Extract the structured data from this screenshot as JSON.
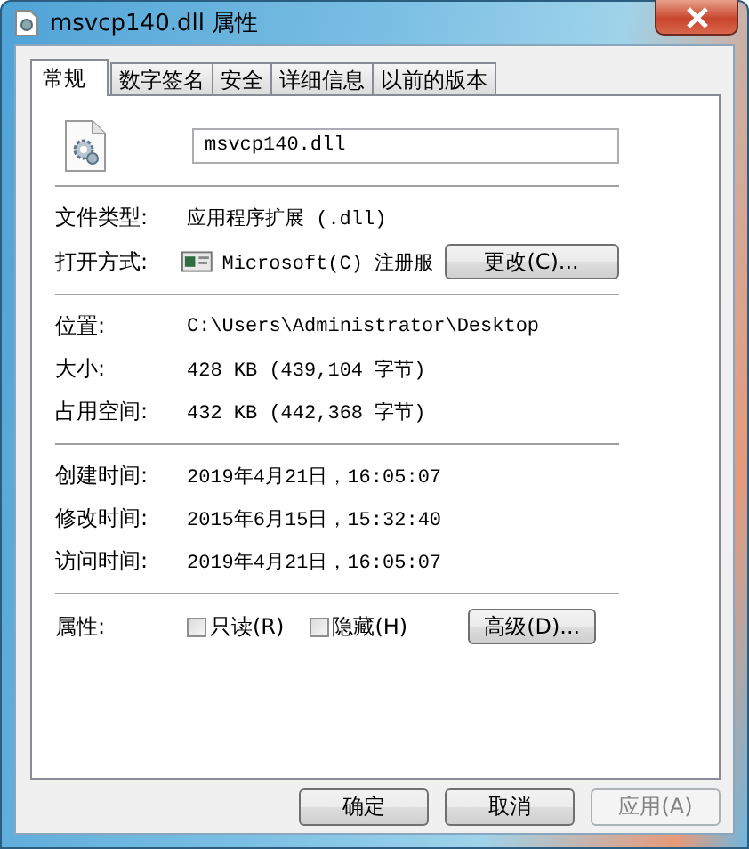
{
  "window": {
    "title": "msvcp140.dll 属性"
  },
  "tabs": [
    {
      "label": "常规",
      "selected": true
    },
    {
      "label": "数字签名",
      "selected": false
    },
    {
      "label": "安全",
      "selected": false
    },
    {
      "label": "详细信息",
      "selected": false
    },
    {
      "label": "以前的版本",
      "selected": false
    }
  ],
  "file_name": {
    "value": "msvcp140.dll"
  },
  "groups": [
    [
      {
        "kind": "text",
        "label": "文件类型:",
        "value": "应用程序扩展 (.dll)"
      },
      {
        "kind": "opens_with",
        "label": "打开方式:",
        "value": "Microsoft(C) 注册服",
        "button": "更改(C)..."
      }
    ],
    [
      {
        "kind": "text",
        "label": "位置:",
        "value": "C:\\Users\\Administrator\\Desktop"
      },
      {
        "kind": "text",
        "label": "大小:",
        "value": "428 KB (439,104 字节)"
      },
      {
        "kind": "text",
        "label": "占用空间:",
        "value": "432 KB (442,368 字节)"
      }
    ],
    [
      {
        "kind": "text",
        "label": "创建时间:",
        "value": "2019年4月21日，16:05:07"
      },
      {
        "kind": "text",
        "label": "修改时间:",
        "value": "2015年6月15日，15:32:40"
      },
      {
        "kind": "text",
        "label": "访问时间:",
        "value": "2019年4月21日，16:05:07"
      }
    ],
    [
      {
        "kind": "attributes",
        "label": "属性:",
        "checkboxes": [
          {
            "label": "只读(R)",
            "checked": false
          },
          {
            "label": "隐藏(H)",
            "checked": false
          }
        ],
        "button": "高级(D)..."
      }
    ]
  ],
  "buttons": [
    {
      "label": "确定",
      "disabled": false
    },
    {
      "label": "取消",
      "disabled": false
    },
    {
      "label": "应用(A)",
      "disabled": true
    }
  ]
}
